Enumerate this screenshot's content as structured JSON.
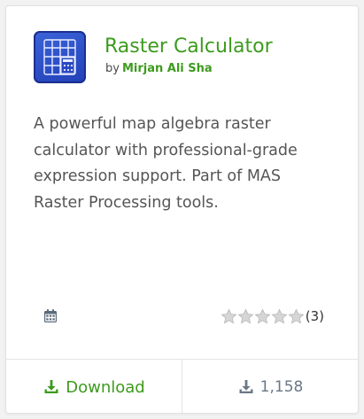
{
  "plugin": {
    "title": "Raster Calculator",
    "by_prefix": "by",
    "author": "Mirjan Ali Sha",
    "description": "A powerful map algebra raster calculator with professional-grade expression support. Part of MAS Raster Processing tools.",
    "icon": "raster-grid-calculator-icon"
  },
  "meta": {
    "calendar_icon": "calendar-icon",
    "rating": {
      "stars_filled": 0,
      "stars_total": 5,
      "count_label": "(3)"
    }
  },
  "footer": {
    "download_label": "Download",
    "download_count": "1,158",
    "download_icon": "download-icon"
  },
  "colors": {
    "accent_green": "#3d9b1e",
    "icon_blue": "#2b4bc8",
    "muted": "#6a7886"
  }
}
